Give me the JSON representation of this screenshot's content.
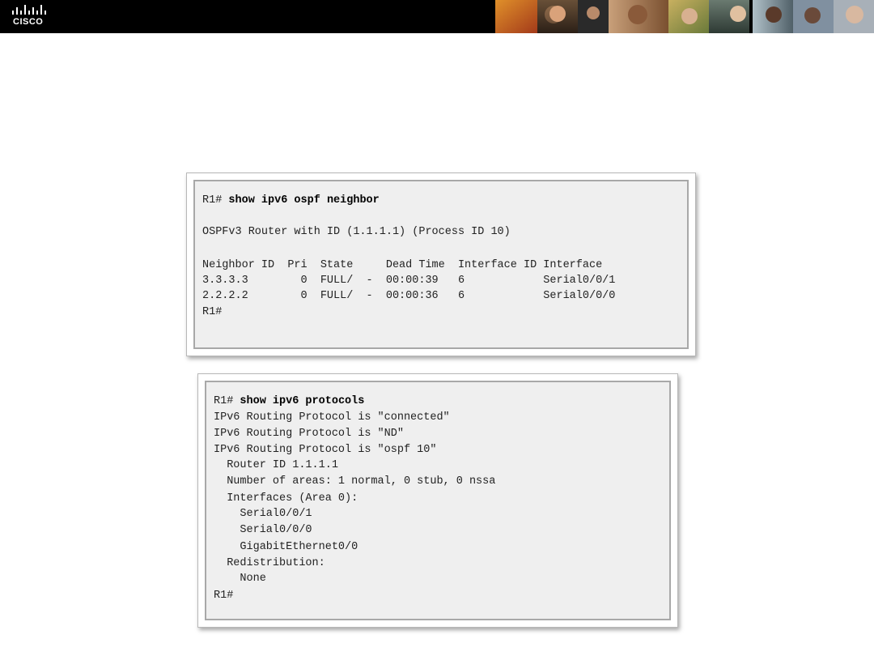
{
  "header": {
    "logo_text": "CISCO",
    "photo_strip_icon": "people-photo-strip"
  },
  "panel1": {
    "prompt": "R1#",
    "command": "show ipv6 ospf neighbor",
    "router_line": "OSPFv3 Router with ID (1.1.1.1) (Process ID 10)",
    "table_header": "Neighbor ID  Pri  State     Dead Time  Interface ID Interface",
    "rows": [
      "3.3.3.3        0  FULL/  -  00:00:39   6            Serial0/0/1",
      "2.2.2.2        0  FULL/  -  00:00:36   6            Serial0/0/0"
    ],
    "end_prompt": "R1#"
  },
  "panel2": {
    "prompt": "R1#",
    "command": "show ipv6 protocols",
    "lines": [
      "IPv6 Routing Protocol is \"connected\"",
      "IPv6 Routing Protocol is \"ND\"",
      "IPv6 Routing Protocol is \"ospf 10\"",
      "  Router ID 1.1.1.1",
      "  Number of areas: 1 normal, 0 stub, 0 nssa",
      "  Interfaces (Area 0):",
      "    Serial0/0/1",
      "    Serial0/0/0",
      "    GigabitEthernet0/0",
      "  Redistribution:",
      "    None"
    ],
    "end_prompt": "R1#"
  }
}
